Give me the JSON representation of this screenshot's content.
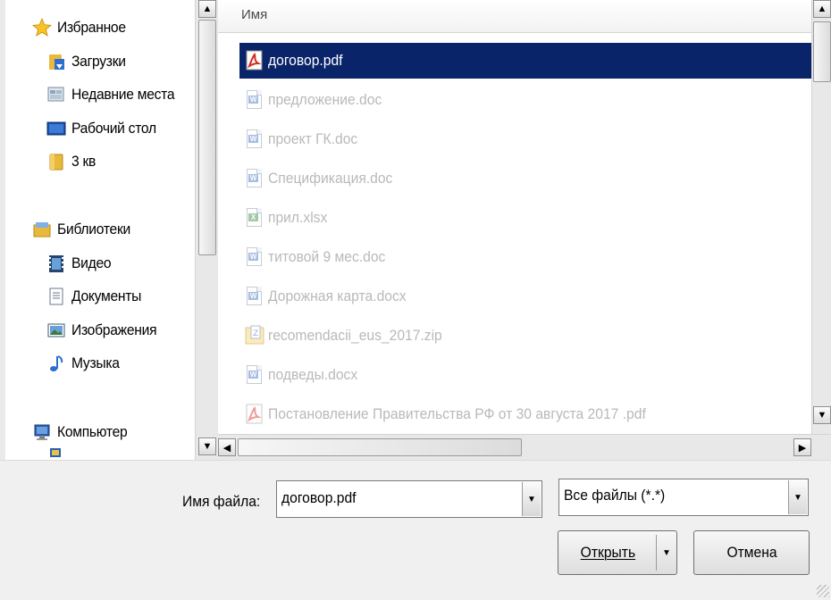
{
  "navigation": {
    "items": [
      {
        "label": "Избранное",
        "icon": "star-icon"
      },
      {
        "label": "Загрузки",
        "icon": "downloads-folder-icon"
      },
      {
        "label": "Недавние места",
        "icon": "recent-places-icon"
      },
      {
        "label": "Рабочий стол",
        "icon": "desktop-icon"
      },
      {
        "label": "3 кв",
        "icon": "folder-icon"
      },
      {
        "label": "Библиотеки",
        "icon": "libraries-icon"
      },
      {
        "label": "Видео",
        "icon": "video-icon"
      },
      {
        "label": "Документы",
        "icon": "documents-icon"
      },
      {
        "label": "Изображения",
        "icon": "pictures-icon"
      },
      {
        "label": "Музыка",
        "icon": "music-icon"
      },
      {
        "label": "Компьютер",
        "icon": "computer-icon"
      }
    ]
  },
  "file_list": {
    "column_header": "Имя",
    "files": [
      {
        "name": "договор.pdf",
        "type": "pdf",
        "selected": true
      },
      {
        "name": "предложение.doc",
        "type": "doc"
      },
      {
        "name": "проект ГК.doc",
        "type": "doc"
      },
      {
        "name": "Спецификация.doc",
        "type": "doc"
      },
      {
        "name": "прил.xlsx",
        "type": "xlsx"
      },
      {
        "name": "титовой 9 мес.doc",
        "type": "doc"
      },
      {
        "name": "Дорожная карта.docx",
        "type": "doc"
      },
      {
        "name": "recomendacii_eus_2017.zip",
        "type": "zip"
      },
      {
        "name": "подведы.docx",
        "type": "doc"
      },
      {
        "name": "Постановление Правительства РФ от 30 августа 2017 .pdf",
        "type": "pdf"
      }
    ]
  },
  "footer": {
    "filename_label": "Имя файла:",
    "filename_value": "договор.pdf",
    "filetype_value": "Все файлы (*.*)",
    "open_label": "Открыть",
    "cancel_label": "Отмена"
  },
  "colors": {
    "selection": "#0a246a",
    "dim_text": "#b9b9b9",
    "background": "#f0f0f0"
  }
}
